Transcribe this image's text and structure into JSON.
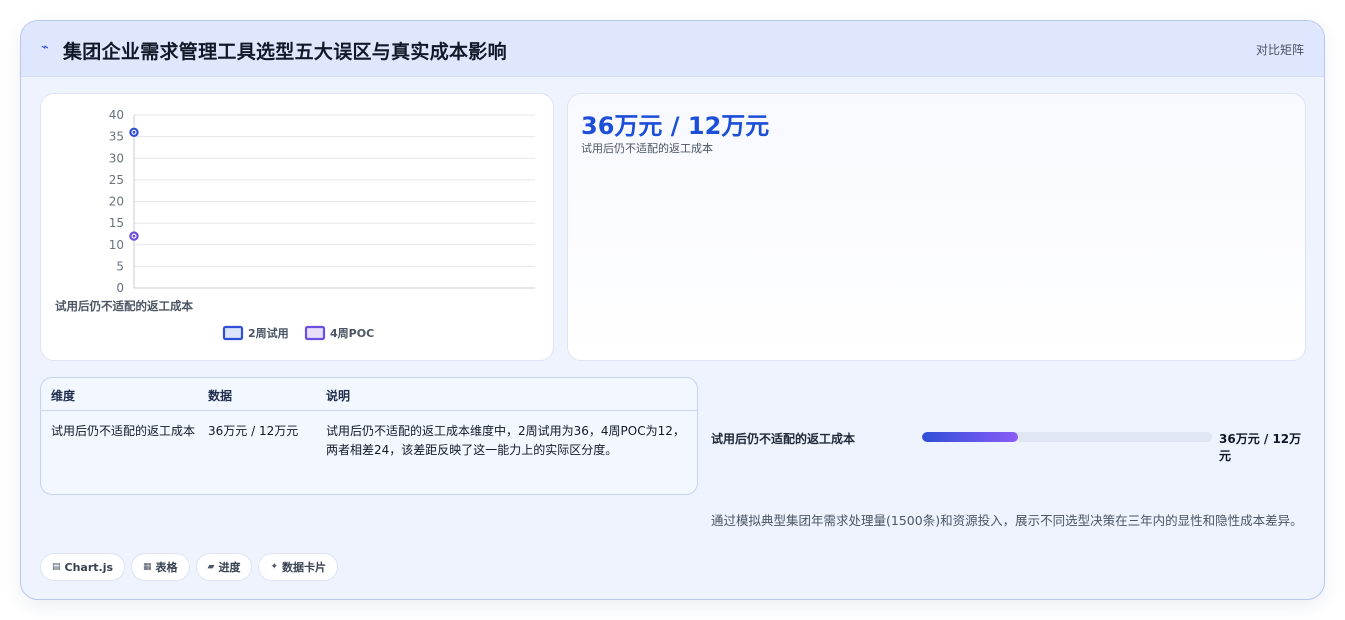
{
  "header": {
    "title": "集团企业需求管理工具选型五大误区与真实成本影响",
    "mode_label": "对比矩阵",
    "icon": "trend-icon"
  },
  "chart_data": {
    "type": "line",
    "categories": [
      "试用后仍不适配的返工成本"
    ],
    "series": [
      {
        "name": "2周试用",
        "values": [
          36
        ],
        "color": "#2f4fd6"
      },
      {
        "name": "4周POC",
        "values": [
          12
        ],
        "color": "#6d4fe0"
      }
    ],
    "ylim": [
      0,
      40
    ],
    "yticks": [
      0,
      5,
      10,
      15,
      20,
      25,
      30,
      35,
      40
    ],
    "legend": "bottom",
    "grid": true
  },
  "stat": {
    "value": "36万元 / 12万元",
    "label": "试用后仍不适配的返工成本"
  },
  "table": {
    "headers": [
      "维度",
      "数据",
      "说明"
    ],
    "rows": [
      [
        "试用后仍不适配的返工成本",
        "36万元 / 12万元",
        "试用后仍不适配的返工成本维度中，2周试用为36，4周POC为12，两者相差24，该差距反映了这一能力上的实际区分度。"
      ]
    ]
  },
  "progress": {
    "label": "试用后仍不适配的返工成本",
    "value_text": "36万元 / 12万元",
    "fraction": 0.33
  },
  "note": "通过模拟典型集团年需求处理量(1500条)和资源投入，展示不同选型决策在三年内的显性和隐性成本差异。",
  "chips": [
    {
      "icon": "▤",
      "label": "Chart.js"
    },
    {
      "icon": "▦",
      "label": "表格"
    },
    {
      "icon": "▰",
      "label": "进度"
    },
    {
      "icon": "✦",
      "label": "数据卡片"
    }
  ],
  "colors": {
    "accent": "#1d4ed8",
    "series_a": "#2f4fd6",
    "series_b": "#6d4fe0"
  }
}
